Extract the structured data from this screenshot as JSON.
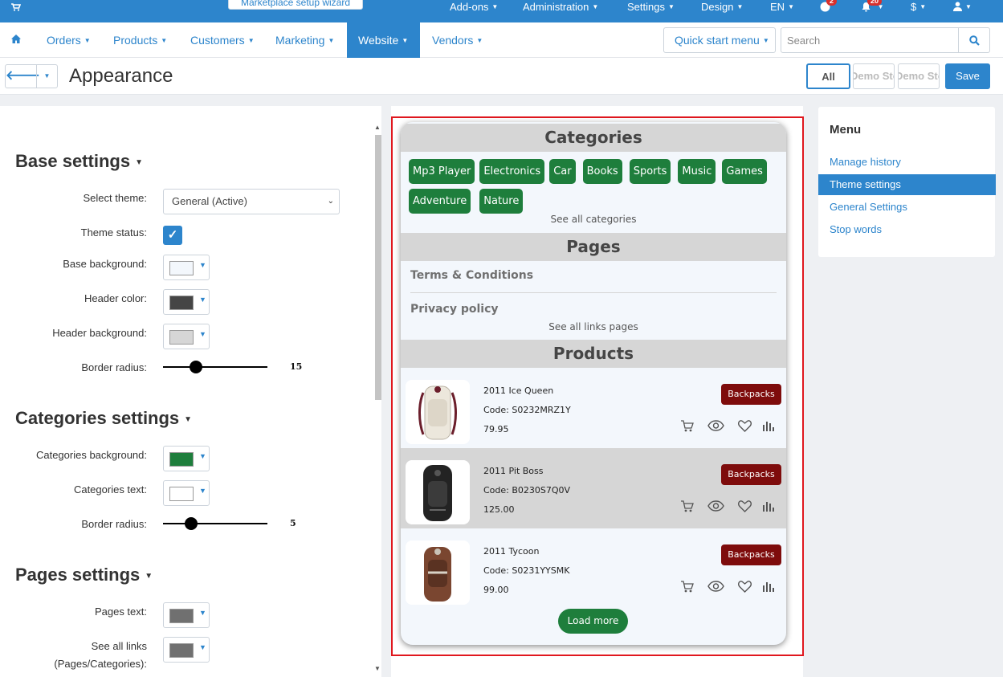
{
  "topbar": {
    "wizard": "Marketplace setup wizard",
    "menu": [
      "Add-ons",
      "Administration",
      "Settings",
      "Design",
      "EN"
    ],
    "help_badge": "2",
    "notif_badge": "20",
    "currency": "$"
  },
  "nav": {
    "items": [
      "Orders",
      "Products",
      "Customers",
      "Marketing",
      "Website",
      "Vendors"
    ],
    "quick_start": "Quick start menu",
    "search_placeholder": "Search"
  },
  "title": {
    "page": "Appearance",
    "all": "All",
    "demo1": "Demo Store",
    "demo2": "Demo Store",
    "save": "Save"
  },
  "form": {
    "base": {
      "title": "Base settings",
      "select_theme_label": "Select theme:",
      "select_theme_value": "General (Active)",
      "theme_status_label": "Theme status:",
      "base_bg_label": "Base background:",
      "header_color_label": "Header color:",
      "header_bg_label": "Header background:",
      "radius_label": "Border radius:",
      "radius_value": "15"
    },
    "categories": {
      "title": "Categories settings",
      "bg_label": "Categories background:",
      "text_label": "Categories text:",
      "radius_label": "Border radius:",
      "radius_value": "5"
    },
    "pages": {
      "title": "Pages settings",
      "text_label": "Pages text:",
      "seeall_label_1": "See all links",
      "seeall_label_2": "(Pages/Categories):"
    }
  },
  "colors": {
    "base_bg": "#f3f7fc",
    "header_color": "#454545",
    "header_bg": "#d6d6d6",
    "categories_bg": "#1e7e3c",
    "categories_text": "#ffffff",
    "pages_text": "#707070",
    "seeall": "#707070"
  },
  "preview": {
    "categories_title": "Categories",
    "categories": [
      "Mp3 Player",
      "Electronics",
      "Car",
      "Books",
      "Sports",
      "Music",
      "Games",
      "Adventure",
      "Nature"
    ],
    "see_all_categories": "See all categories",
    "pages_title": "Pages",
    "pages": [
      "Terms & Conditions",
      "Privacy policy"
    ],
    "see_all_pages": "See all links pages",
    "products_title": "Products",
    "products": [
      {
        "name": "2011 Ice Queen",
        "code": "Code: S0232MRZ1Y",
        "price": "79.95",
        "badge": "Backpacks"
      },
      {
        "name": "2011 Pit Boss",
        "code": "Code: B0230S7Q0V",
        "price": "125.00",
        "badge": "Backpacks"
      },
      {
        "name": "2011 Tycoon",
        "code": "Code: S0231YYSMK",
        "price": "99.00",
        "badge": "Backpacks"
      }
    ],
    "load_more": "Load more"
  },
  "sidemenu": {
    "title": "Menu",
    "items": [
      "Manage history",
      "Theme settings",
      "General Settings",
      "Stop words"
    ]
  }
}
